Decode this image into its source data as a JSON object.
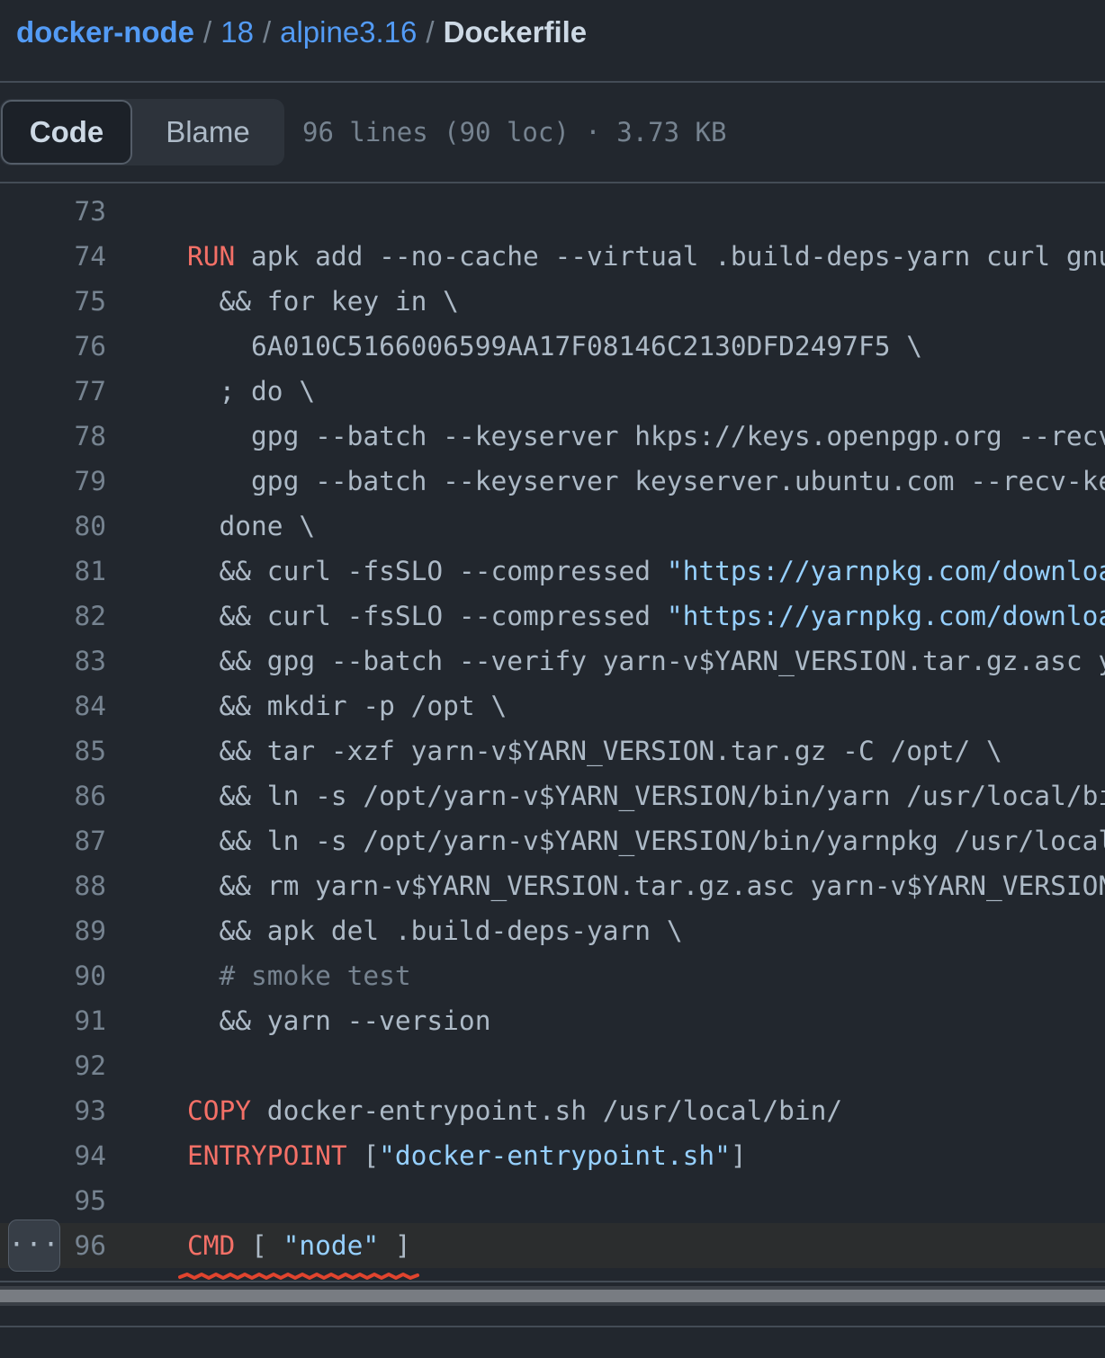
{
  "breadcrumb": {
    "repo": "docker-node",
    "sep": "/",
    "folder1": "18",
    "folder2": "alpine3.16",
    "file": "Dockerfile"
  },
  "toolbar": {
    "code_label": "Code",
    "blame_label": "Blame",
    "file_meta": "96 lines (90 loc) · 3.73 KB"
  },
  "line_menu_label": "···",
  "colors": {
    "background": "#22272e",
    "link": "#539bf5",
    "keyword": "#f47067",
    "string": "#96d0ff",
    "annotation_underline": "#e0442e"
  },
  "code": {
    "lines": [
      {
        "n": "73",
        "segs": [
          {
            "t": ""
          }
        ]
      },
      {
        "n": "74",
        "segs": [
          {
            "t": "RUN",
            "c": "kw"
          },
          {
            "t": " apk add --no-cache --virtual .build-deps-yarn curl gnupg tar \\"
          }
        ]
      },
      {
        "n": "75",
        "segs": [
          {
            "t": "  && for key in \\"
          }
        ]
      },
      {
        "n": "76",
        "segs": [
          {
            "t": "    6A010C5166006599AA17F08146C2130DFD2497F5 \\"
          }
        ]
      },
      {
        "n": "77",
        "segs": [
          {
            "t": "  ; do \\"
          }
        ]
      },
      {
        "n": "78",
        "segs": [
          {
            "t": "    gpg --batch --keyserver hkps://keys.openpgp.org --recv-keys \"$key\" ||"
          }
        ]
      },
      {
        "n": "79",
        "segs": [
          {
            "t": "    gpg --batch --keyserver keyserver.ubuntu.com --recv-keys \"$key\" ;"
          }
        ]
      },
      {
        "n": "80",
        "segs": [
          {
            "t": "  done \\"
          }
        ]
      },
      {
        "n": "81",
        "segs": [
          {
            "t": "  && curl -fsSLO --compressed "
          },
          {
            "t": "\"https://yarnpkg.com/downloads/$YARN_VERSION/yarn-v$YARN_VERSION.tar.gz\"",
            "c": "str"
          },
          {
            "t": " \\"
          }
        ]
      },
      {
        "n": "82",
        "segs": [
          {
            "t": "  && curl -fsSLO --compressed "
          },
          {
            "t": "\"https://yarnpkg.com/downloads/$YARN_VERSION/yarn-v$YARN_VERSION.tar.gz.asc\"",
            "c": "str"
          },
          {
            "t": " \\"
          }
        ]
      },
      {
        "n": "83",
        "segs": [
          {
            "t": "  && gpg --batch --verify yarn-v$YARN_VERSION.tar.gz.asc yarn-v$YARN_VERSION.tar.gz \\"
          }
        ]
      },
      {
        "n": "84",
        "segs": [
          {
            "t": "  && mkdir -p /opt \\"
          }
        ]
      },
      {
        "n": "85",
        "segs": [
          {
            "t": "  && tar -xzf yarn-v$YARN_VERSION.tar.gz -C /opt/ \\"
          }
        ]
      },
      {
        "n": "86",
        "segs": [
          {
            "t": "  && ln -s /opt/yarn-v$YARN_VERSION/bin/yarn /usr/local/bin/yarn \\"
          }
        ]
      },
      {
        "n": "87",
        "segs": [
          {
            "t": "  && ln -s /opt/yarn-v$YARN_VERSION/bin/yarnpkg /usr/local/bin/yarnpkg \\"
          }
        ]
      },
      {
        "n": "88",
        "segs": [
          {
            "t": "  && rm yarn-v$YARN_VERSION.tar.gz.asc yarn-v$YARN_VERSION.tar.gz \\"
          }
        ]
      },
      {
        "n": "89",
        "segs": [
          {
            "t": "  && apk del .build-deps-yarn \\"
          }
        ]
      },
      {
        "n": "90",
        "segs": [
          {
            "t": "  # smoke test",
            "c": "cmt"
          }
        ]
      },
      {
        "n": "91",
        "segs": [
          {
            "t": "  && yarn --version"
          }
        ]
      },
      {
        "n": "92",
        "segs": [
          {
            "t": ""
          }
        ]
      },
      {
        "n": "93",
        "segs": [
          {
            "t": "COPY",
            "c": "kw"
          },
          {
            "t": " docker-entrypoint.sh /usr/local/bin/"
          }
        ]
      },
      {
        "n": "94",
        "segs": [
          {
            "t": "ENTRYPOINT",
            "c": "kw"
          },
          {
            "t": " ["
          },
          {
            "t": "\"docker-entrypoint.sh\"",
            "c": "str"
          },
          {
            "t": "]"
          }
        ]
      },
      {
        "n": "95",
        "segs": [
          {
            "t": ""
          }
        ]
      },
      {
        "n": "96",
        "segs": [
          {
            "t": "CMD",
            "c": "kw"
          },
          {
            "t": " [ "
          },
          {
            "t": "\"node\"",
            "c": "str"
          },
          {
            "t": " ]"
          }
        ],
        "highlight": true
      }
    ]
  }
}
